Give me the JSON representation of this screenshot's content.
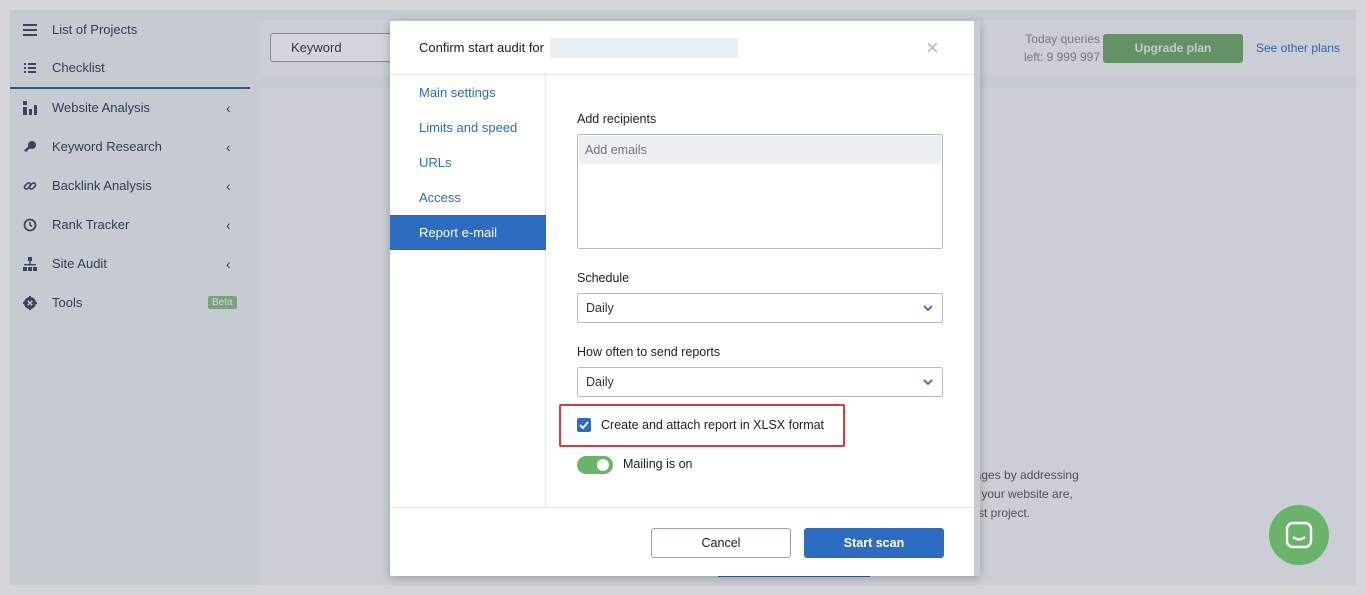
{
  "sidebar": {
    "items": [
      {
        "label": "List of Projects",
        "icon": "menu-icon"
      },
      {
        "label": "Checklist",
        "icon": "list-icon"
      },
      {
        "label": "Website Analysis",
        "icon": "bar-chart-icon",
        "chevron": "‹"
      },
      {
        "label": "Keyword Research",
        "icon": "key-icon",
        "chevron": "‹"
      },
      {
        "label": "Backlink Analysis",
        "icon": "link-icon",
        "chevron": "‹"
      },
      {
        "label": "Rank Tracker",
        "icon": "history-icon",
        "chevron": "‹"
      },
      {
        "label": "Site Audit",
        "icon": "sitemap-icon",
        "chevron": "‹"
      },
      {
        "label": "Tools",
        "icon": "gear-icon",
        "badge": "Beta"
      }
    ]
  },
  "topbar": {
    "keyword_button": "Keyword",
    "queries_line1": "Today queries",
    "queries_line2": "left: 9 999 997",
    "upgrade_label": "Upgrade plan",
    "other_plans_label": "See other plans"
  },
  "background": {
    "line1": "pages by addressing",
    "line2": "of your website are,",
    "line3": "first project."
  },
  "modal": {
    "title": "Confirm start audit for",
    "close_glyph": "×",
    "tabs": [
      {
        "label": "Main settings"
      },
      {
        "label": "Limits and speed"
      },
      {
        "label": "URLs"
      },
      {
        "label": "Access"
      },
      {
        "label": "Report e-mail",
        "active": true
      }
    ],
    "recipients_label": "Add recipients",
    "recipients_placeholder": "Add emails",
    "schedule_label": "Schedule",
    "schedule_value": "Daily",
    "frequency_label": "How often to send reports",
    "frequency_value": "Daily",
    "xlsx_label": "Create and attach report in XLSX format",
    "xlsx_checked": true,
    "mailing_label": "Mailing is on",
    "mailing_on": true,
    "cancel_label": "Cancel",
    "start_label": "Start scan"
  },
  "colors": {
    "accent": "#2c6dc2",
    "success": "#6ab36a",
    "highlight": "#d63a3a"
  }
}
